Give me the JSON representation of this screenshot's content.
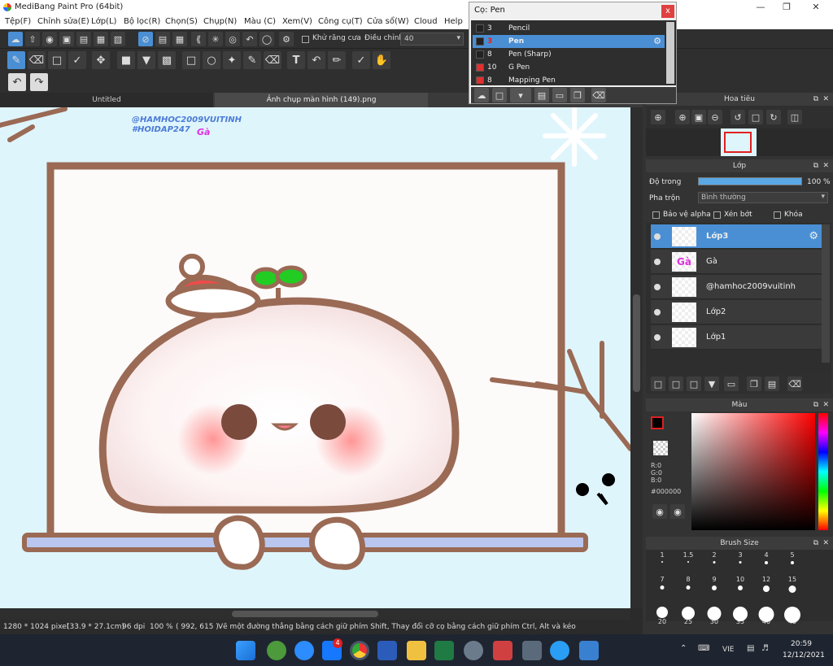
{
  "window": {
    "title": "MediBang Paint Pro (64bit)"
  },
  "menu": [
    "Tệp(F)",
    "Chỉnh sửa(E)",
    "Lớp(L)",
    "Bộ lọc(R)",
    "Chọn(S)",
    "Chụp(N)",
    "Màu (C)",
    "Xem(V)",
    "Công cụ(T)",
    "Cửa sổ(W)",
    "Cloud",
    "Help"
  ],
  "toolbar": {
    "antialias_label": "Khử răng cưa",
    "adjust_label": "Điều chỉnh",
    "adjust_value": "40"
  },
  "tabs": [
    "Untitled",
    "Ảnh chụp màn hình (149).png"
  ],
  "brush_window": {
    "title": "Cọ: Pen",
    "close": "x",
    "items": [
      {
        "size": "3",
        "name": "Pencil",
        "color": "#222222"
      },
      {
        "size": "3",
        "name": "Pen",
        "color": "#222222",
        "selected": true
      },
      {
        "size": "8",
        "name": "Pen (Sharp)",
        "color": "#222222"
      },
      {
        "size": "10",
        "name": "G Pen",
        "color": "#e03030"
      },
      {
        "size": "8",
        "name": "Mapping Pen",
        "color": "#e03030"
      }
    ]
  },
  "navigator": {
    "title": "Hoa tiêu"
  },
  "layers_panel": {
    "title": "Lớp",
    "opacity_label": "Độ trong",
    "opacity_value": "100 %",
    "blend_label": "Pha trộn",
    "blend_value": "Bình thường",
    "protect_alpha": "Bảo vệ alpha",
    "clip": "Xén bớt",
    "lock": "Khóa",
    "layers": [
      {
        "name": "Lớp3",
        "selected": true
      },
      {
        "name": "Gà"
      },
      {
        "name": "@hamhoc2009vuitinh"
      },
      {
        "name": "Lớp2"
      },
      {
        "name": "Lớp1"
      }
    ]
  },
  "color_panel": {
    "title": "Màu",
    "r": "R:0",
    "g": "G:0",
    "b": "B:0",
    "hex": "#000000"
  },
  "brush_size_panel": {
    "title": "Brush Size",
    "sizes": [
      "1",
      "1.5",
      "2",
      "3",
      "4",
      "5",
      "7",
      "8",
      "9",
      "10",
      "12",
      "15",
      "20",
      "25",
      "30",
      "35",
      "40",
      "45"
    ]
  },
  "canvas": {
    "watermark_line1": "@HAMHOC2009VUITINH",
    "watermark_line2": "#HOIDAP247",
    "label_ga": "Gà"
  },
  "status": {
    "dimensions": "1280 * 1024 pixel",
    "physical": "(33.9 * 27.1cm)",
    "dpi": "96 dpi",
    "zoom": "100 %",
    "coords": "( 992, 615 )",
    "hint": "Vẽ một đường thẳng bằng cách giữ phím Shift, Thay đổi cỡ cọ bằng cách giữ phím Ctrl, Alt và kéo"
  },
  "taskbar": {
    "lang": "VIE",
    "time": "20:59",
    "date": "12/12/2021",
    "badge": "4"
  }
}
